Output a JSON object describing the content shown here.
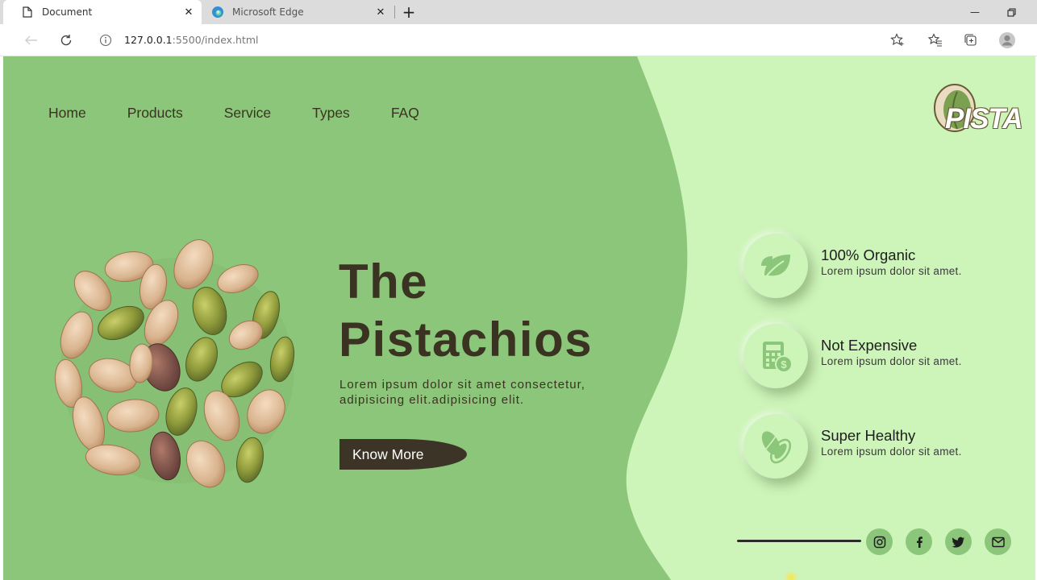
{
  "browser": {
    "tabs": [
      {
        "title": "Document",
        "active": true
      },
      {
        "title": "Microsoft Edge",
        "active": false
      }
    ],
    "address": {
      "host": "127.0.0.1",
      "path": ":5500/index.html"
    }
  },
  "page": {
    "colors": {
      "primary_green": "#8cc67a",
      "light_green": "#cdf4b9",
      "dark": "#3a3322"
    },
    "nav": [
      "Home",
      "Products",
      "Service",
      "Types",
      "FAQ"
    ],
    "logo_text": "PISTA",
    "hero": {
      "title_line1": "The",
      "title_line2": "Pistachios",
      "description_line1": "Lorem ipsum dolor sit amet consectetur,",
      "description_line2": "adipisicing elit.adipisicing elit.",
      "button_label": "Know More"
    },
    "features": [
      {
        "title": "100% Organic",
        "desc": "Lorem ipsum dolor sit amet.",
        "icon": "leaf-icon"
      },
      {
        "title": "Not Expensive",
        "desc": "Lorem ipsum dolor sit amet.",
        "icon": "calculator-dollar-icon"
      },
      {
        "title": "Super Healthy",
        "desc": "Lorem ipsum dolor sit amet.",
        "icon": "pistachio-icon"
      }
    ],
    "social": [
      "instagram-icon",
      "facebook-icon",
      "twitter-icon",
      "mail-icon"
    ]
  }
}
